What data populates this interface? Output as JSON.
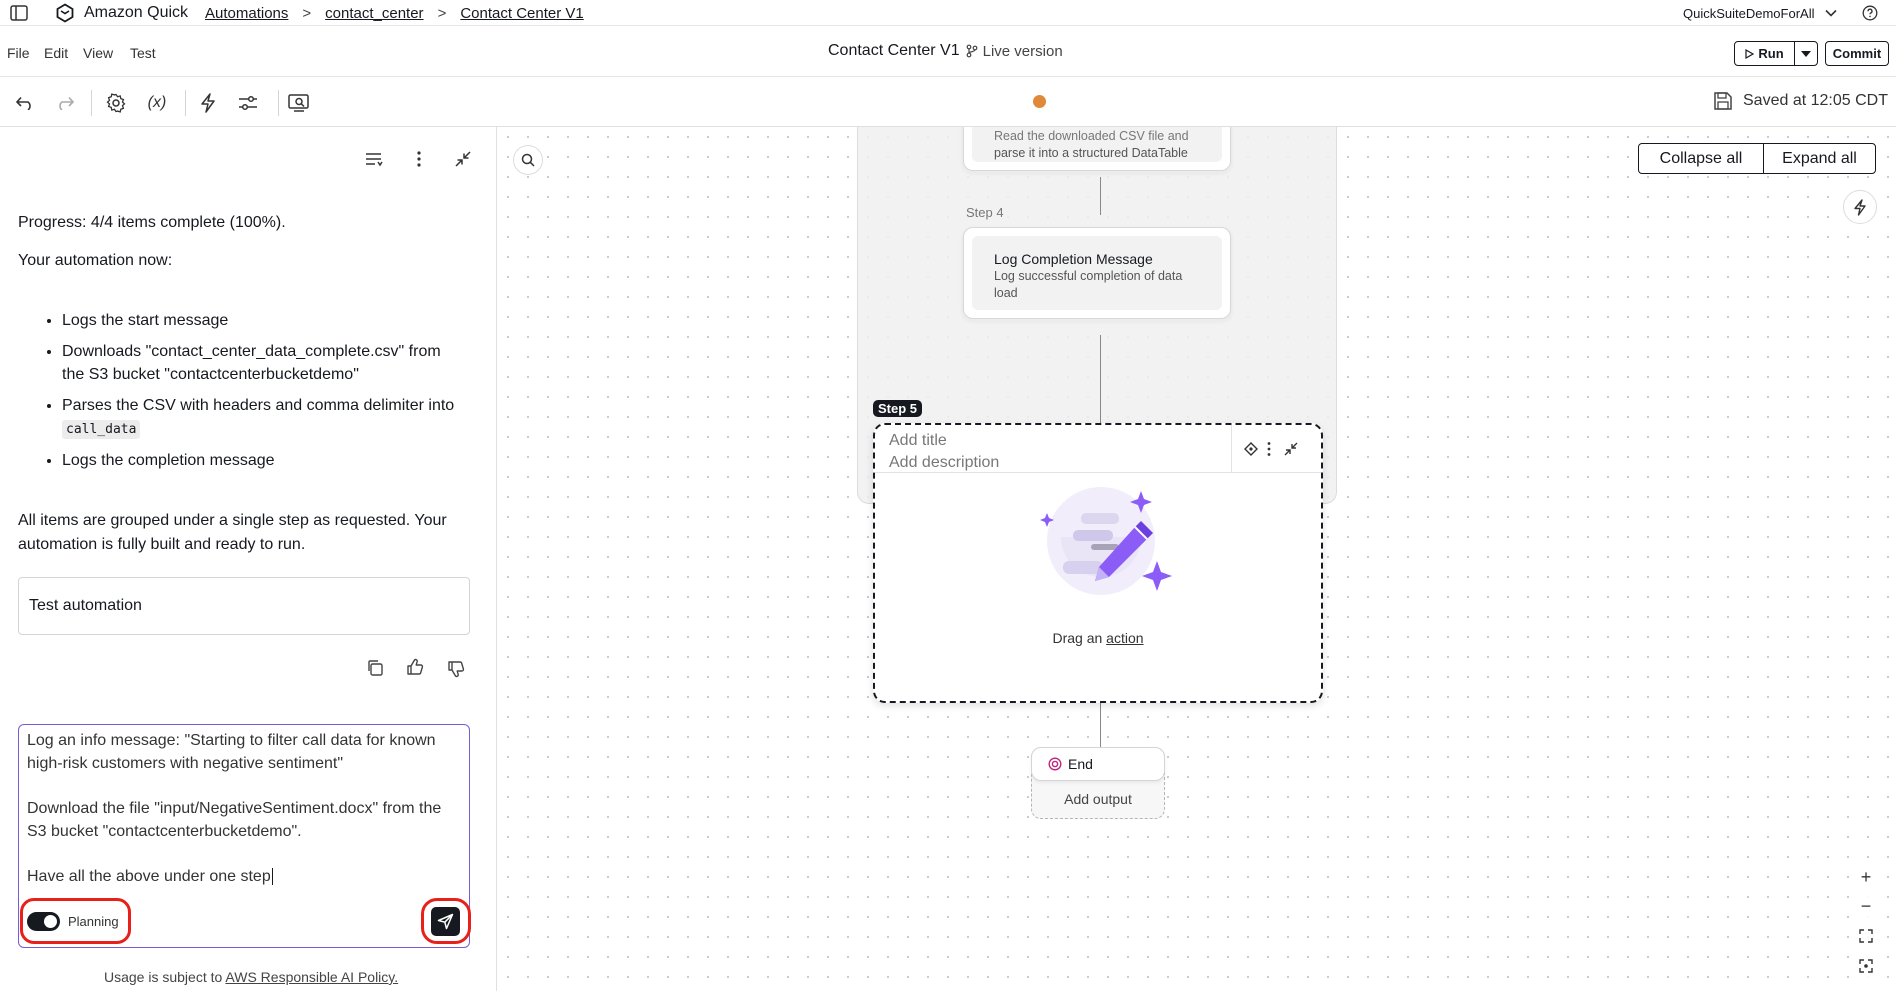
{
  "topbar": {
    "app_name": "Amazon Quick",
    "breadcrumbs": [
      "Automations",
      "contact_center",
      "Contact Center V1"
    ],
    "separator": ">",
    "account": "QuickSuiteDemoForAll"
  },
  "menu": {
    "items": [
      "File",
      "Edit",
      "View",
      "Test"
    ],
    "doc_title": "Contact Center V1",
    "version": "Live version",
    "run_label": "Run",
    "commit_label": "Commit"
  },
  "toolbar": {
    "variables_label": "(x)",
    "saved_status": "Saved at 12:05 CDT"
  },
  "chat": {
    "progress": "Progress: 4/4 items complete (100%).",
    "intro": "Your automation now:",
    "bullets": [
      "Logs the start message",
      "Downloads \"contact_center_data_complete.csv\" from the S3 bucket \"contactcenterbucketdemo\"",
      "Parses the CSV with headers and comma delimiter into",
      "Logs the completion message"
    ],
    "bullet_code": "call_data",
    "summary": "All items are grouped under a single step as requested. Your automation is fully built and ready to run.",
    "suggestion": "Test automation",
    "input_lines": [
      "Log an info message: \"Starting to filter call data for known",
      "high-risk customers with negative sentiment\"",
      "Download the file \"input/NegativeSentiment.docx\" from the",
      "S3 bucket \"contactcenterbucketdemo\".",
      "Have all the above under one step"
    ],
    "planning_label": "Planning",
    "planning_on": true,
    "footer_prefix": "Usage is subject to ",
    "footer_link": "AWS Responsible AI Policy."
  },
  "canvas": {
    "collapse_all": "Collapse all",
    "expand_all": "Expand all",
    "step3_desc_line1": "Read the downloaded CSV file and",
    "step3_desc_line2": "parse it into a structured DataTable",
    "step4_label": "Step 4",
    "step4_title": "Log Completion Message",
    "step4_desc_line1": "Log successful completion of data",
    "step4_desc_line2": "load",
    "step5_badge": "Step 5",
    "step5_title_placeholder": "Add title",
    "step5_desc_placeholder": "Add description",
    "drag_prefix": "Drag an ",
    "drag_link": "action",
    "end_label": "End",
    "add_output": "Add output",
    "zoom_in": "+",
    "zoom_out": "−"
  },
  "colors": {
    "accent_purple": "#8b5cf6",
    "highlight_red": "#e8201a",
    "status_orange": "#e0893a",
    "end_pink": "#c0267c"
  }
}
